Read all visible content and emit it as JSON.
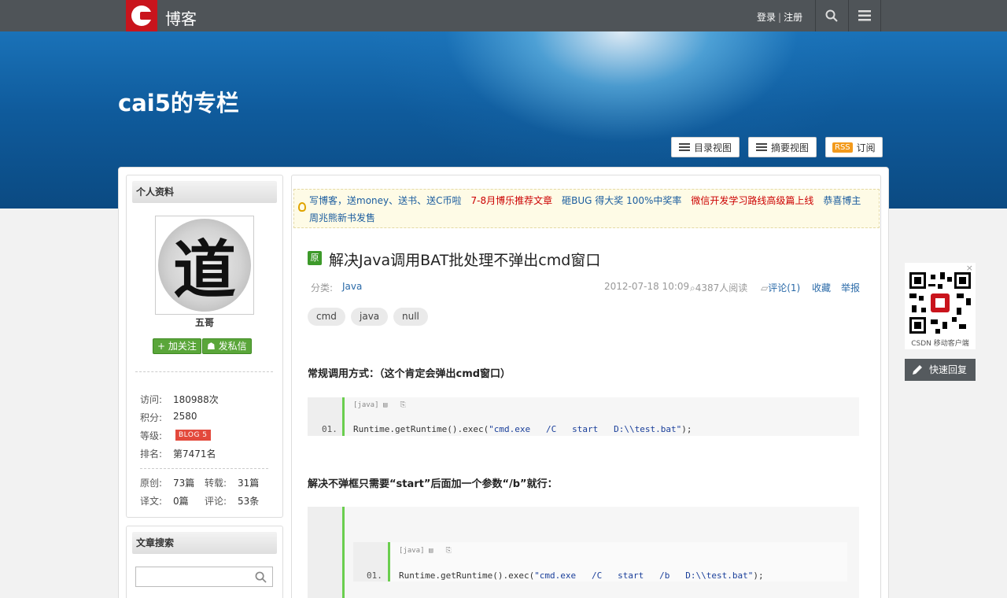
{
  "topbar": {
    "brand": "博客",
    "login": "登录",
    "register": "注册"
  },
  "banner": {
    "blog_title": "cai5的专栏",
    "catalog_view": "目录视图",
    "summary_view": "摘要视图",
    "rss_badge": "RSS",
    "subscribe": "订阅"
  },
  "profile": {
    "header": "个人资料",
    "avatar_glyph": "道",
    "name": "五哥",
    "follow": "加关注",
    "message": "发私信",
    "stats": [
      {
        "k": "访问:",
        "v": "180988次"
      },
      {
        "k": "积分:",
        "v": "2580"
      },
      {
        "k": "等级:",
        "v": "BLOG 5"
      },
      {
        "k": "排名:",
        "v": "第7471名"
      }
    ],
    "counts": [
      {
        "k": "原创:",
        "v": "73篇"
      },
      {
        "k": "转载:",
        "v": "31篇"
      },
      {
        "k": "译文:",
        "v": "0篇"
      },
      {
        "k": "评论:",
        "v": "53条"
      }
    ]
  },
  "search_panel": {
    "header": "文章搜索"
  },
  "notice": {
    "items": [
      {
        "text": "写博客，送money、送书、送C币啦",
        "color": "blue"
      },
      {
        "text": "7-8月博乐推荐文章",
        "color": "red"
      },
      {
        "text": "砸BUG 得大奖 100%中奖率",
        "color": "blue"
      },
      {
        "text": "微信开发学习路线高级篇上线",
        "color": "red"
      },
      {
        "text": "恭喜博主",
        "color": "blue"
      }
    ],
    "line2": "周兆熊新书发售"
  },
  "article": {
    "badge": "原",
    "title": "解决Java调用BAT批处理不弹出cmd窗口",
    "category_label": "分类:",
    "category": "Java",
    "date": "2012-07-18 10:09",
    "reads": "4387人阅读",
    "comments": "评论(1)",
    "favorite": "收藏",
    "report": "举报",
    "tags": [
      "cmd",
      "java",
      "null"
    ],
    "heading1": "常规调用方式：（这个肯定会弹出cmd窗口）",
    "code1": {
      "lang": "[java]",
      "line_no": "01.",
      "prefix": "Runtime.getRuntime().exec(",
      "string": "\"cmd.exe   /C   start   D:\\\\test.bat\"",
      "suffix": ");"
    },
    "heading2": "解决不弹框只需要“start”后面加一个参数“/b”就行：",
    "code2": {
      "lang": "[java]",
      "line_no": "01.",
      "prefix": "Runtime.getRuntime().exec(",
      "string": "\"cmd.exe   /C   start   /b   D:\\\\test.bat\"",
      "suffix": ");"
    }
  },
  "side": {
    "qr_caption": "CSDN 移动客户端",
    "quick_reply": "快速回复"
  }
}
